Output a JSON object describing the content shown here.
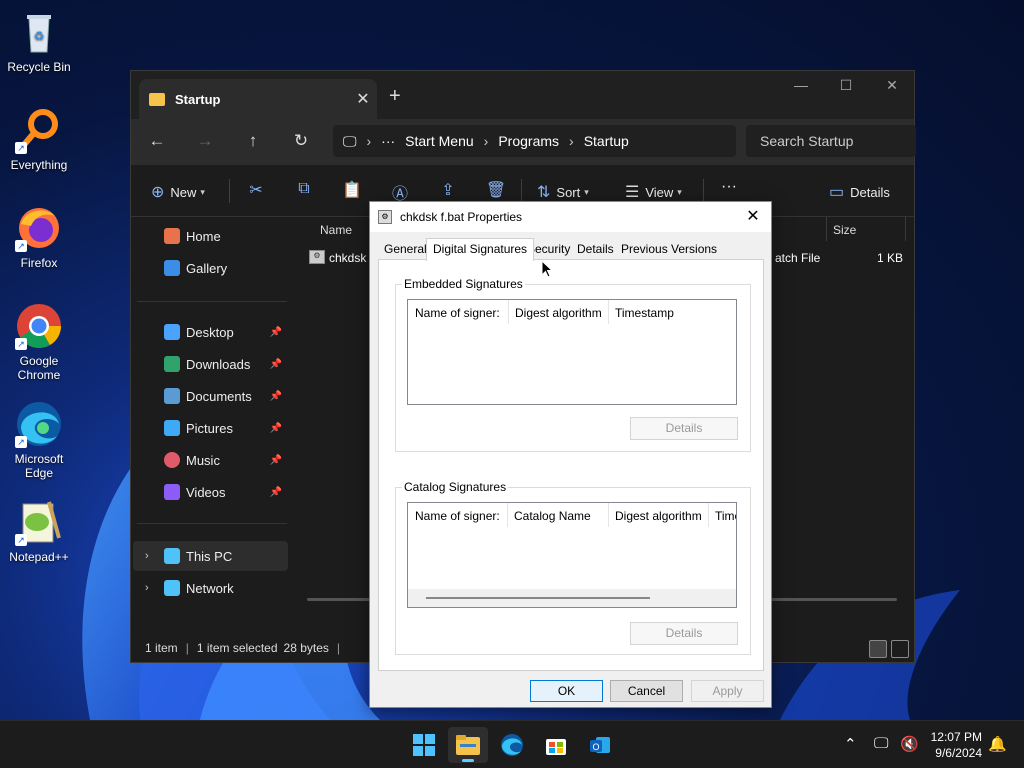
{
  "desktop": {
    "icons": [
      {
        "label": "Recycle Bin",
        "icon": "recycle-bin-icon"
      },
      {
        "label": "Everything",
        "icon": "search-magnifier-icon"
      },
      {
        "label": "Firefox",
        "icon": "firefox-icon"
      },
      {
        "label": "Google Chrome",
        "icon": "chrome-icon"
      },
      {
        "label": "Microsoft Edge",
        "icon": "edge-icon"
      },
      {
        "label": "Notepad++",
        "icon": "notepad-plus-plus-icon"
      }
    ]
  },
  "explorer": {
    "tab_title": "Startup",
    "breadcrumb": [
      "Start Menu",
      "Programs",
      "Startup"
    ],
    "search_placeholder": "Search Startup",
    "toolbar": {
      "new": "New",
      "sort": "Sort",
      "view": "View",
      "details": "Details"
    },
    "sidebar": {
      "home": "Home",
      "gallery": "Gallery",
      "pinned": [
        "Desktop",
        "Downloads",
        "Documents",
        "Pictures",
        "Music",
        "Videos"
      ],
      "this_pc": "This PC",
      "network": "Network"
    },
    "columns": {
      "name": "Name",
      "size": "Size"
    },
    "file": {
      "name": "chkdsk f.bat",
      "name_visible": "chkdsk",
      "type": "Windows Batch File",
      "type_visible": "atch File",
      "size": "1 KB"
    },
    "status": {
      "count": "1 item",
      "selected": "1 item selected",
      "size": "28 bytes"
    }
  },
  "dialog": {
    "title": "chkdsk f.bat Properties",
    "tabs": [
      "General",
      "Digital Signatures",
      "Security",
      "Details",
      "Previous Versions"
    ],
    "selected_tab": "Digital Signatures",
    "embedded": {
      "title": "Embedded Signatures",
      "columns": [
        "Name of signer:",
        "Digest algorithm",
        "Timestamp"
      ],
      "details_button": "Details"
    },
    "catalog": {
      "title": "Catalog Signatures",
      "columns": [
        "Name of signer:",
        "Catalog Name",
        "Digest algorithm",
        "Time"
      ],
      "details_button": "Details"
    },
    "buttons": {
      "ok": "OK",
      "cancel": "Cancel",
      "apply": "Apply"
    }
  },
  "taskbar": {
    "time": "12:07 PM",
    "date": "9/6/2024"
  }
}
